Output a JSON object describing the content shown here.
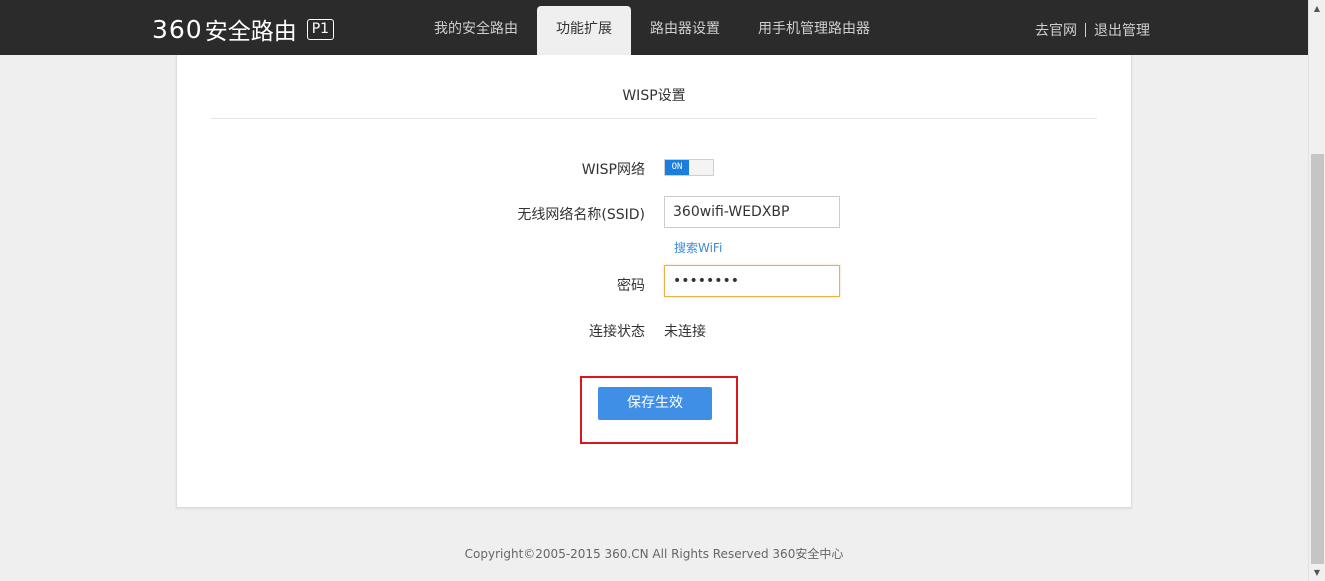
{
  "header": {
    "logo_num": "360",
    "logo_text": "安全路由",
    "logo_model": "P1",
    "nav": [
      {
        "label": "我的安全路由"
      },
      {
        "label": "功能扩展"
      },
      {
        "label": "路由器设置"
      },
      {
        "label": "用手机管理路由器"
      }
    ],
    "active_tab": "功能扩展",
    "links": {
      "official_site": "去官网",
      "logout": "退出管理"
    }
  },
  "panel": {
    "title": "WISP设置",
    "wisp_label": "WISP网络",
    "wisp_toggle": "ON",
    "ssid_label": "无线网络名称(SSID)",
    "ssid_value": "360wifi-WEDXBP",
    "search_wifi": "搜索WiFi",
    "password_label": "密码",
    "password_value": "••••••••",
    "status_label": "连接状态",
    "status_value": "未连接",
    "save_button": "保存生效"
  },
  "footer": {
    "copyright": "Copyright©2005-2015 360.CN All Rights Reserved 360安全中心"
  },
  "colors": {
    "topbar": "#2b2b2b",
    "primary": "#3f8fe6",
    "highlight": "#d9171a",
    "focus": "#e8b048"
  }
}
